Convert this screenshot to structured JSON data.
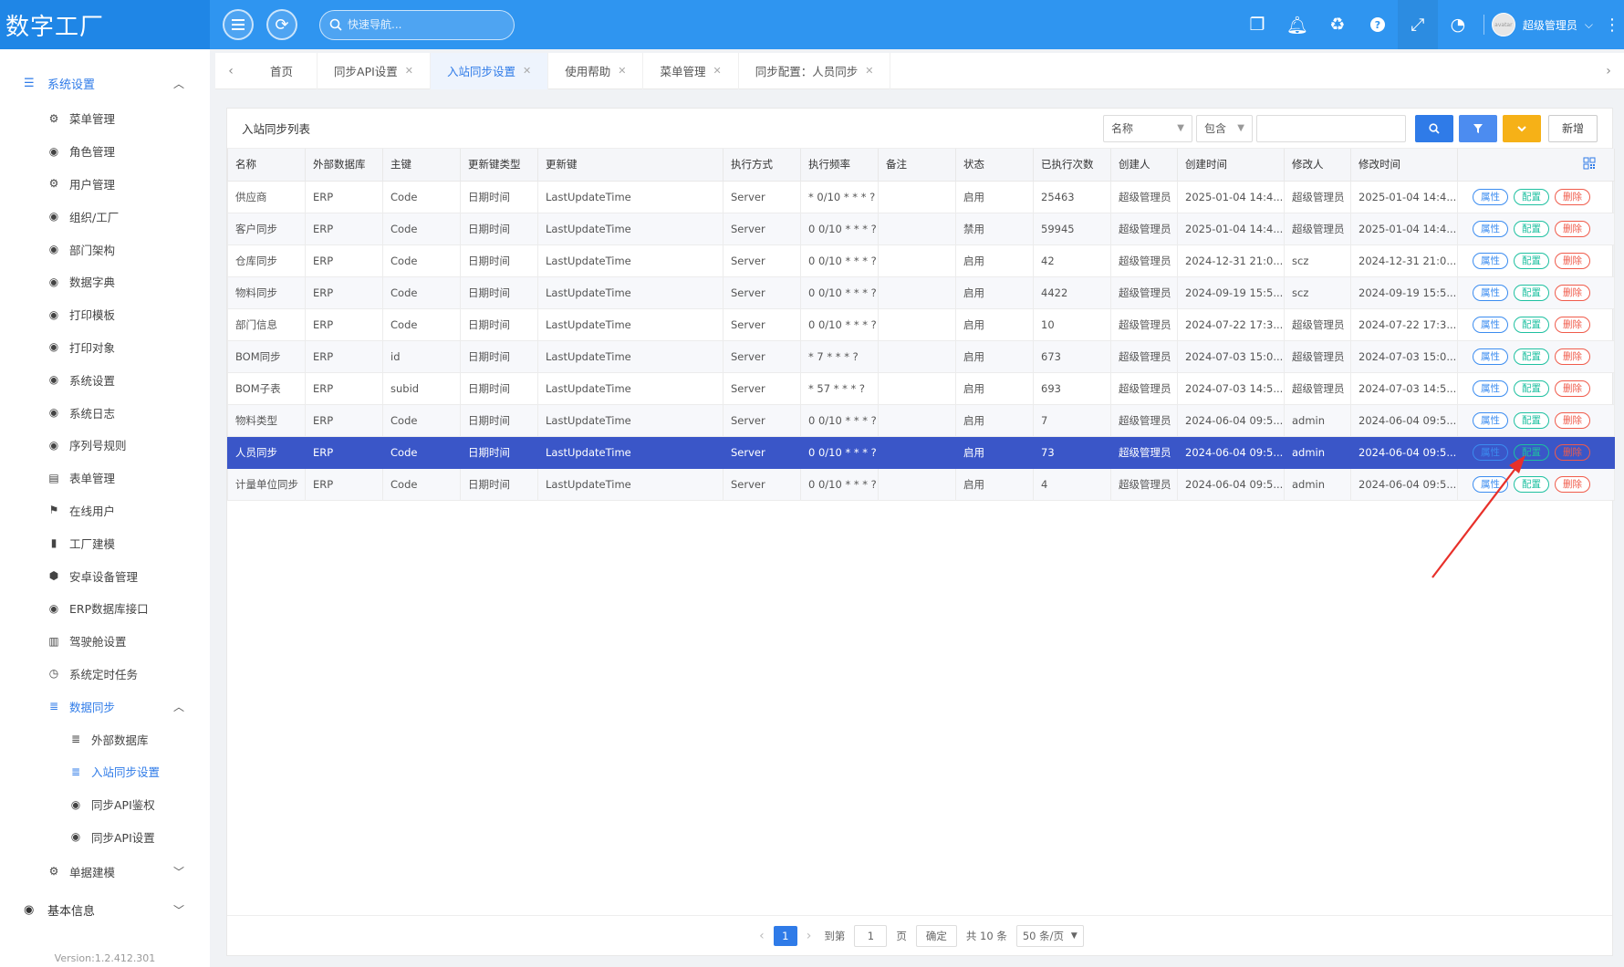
{
  "app": {
    "brand": "数字工厂",
    "search_placeholder": "快速导航...",
    "user_name": "超级管理员",
    "avatar_text": "avatar"
  },
  "sidebar": {
    "group": "系统设置",
    "items": [
      {
        "label": "菜单管理",
        "icon": "gear-icon"
      },
      {
        "label": "角色管理",
        "icon": "circle-icon"
      },
      {
        "label": "用户管理",
        "icon": "gear-icon"
      },
      {
        "label": "组织/工厂",
        "icon": "compass-icon"
      },
      {
        "label": "部门架构",
        "icon": "circle-icon"
      },
      {
        "label": "数据字典",
        "icon": "circle-icon"
      },
      {
        "label": "打印模板",
        "icon": "circle-icon"
      },
      {
        "label": "打印对象",
        "icon": "compass-icon"
      },
      {
        "label": "系统设置",
        "icon": "circle-icon"
      },
      {
        "label": "系统日志",
        "icon": "circle-icon"
      },
      {
        "label": "序列号规则",
        "icon": "compass-icon"
      },
      {
        "label": "表单管理",
        "icon": "form-icon"
      },
      {
        "label": "在线用户",
        "icon": "flag-icon"
      },
      {
        "label": "工厂建模",
        "icon": "cylinder-icon"
      },
      {
        "label": "安卓设备管理",
        "icon": "android-icon"
      },
      {
        "label": "ERP数据库接口",
        "icon": "circle-icon"
      },
      {
        "label": "驾驶舱设置",
        "icon": "bar-chart-icon"
      },
      {
        "label": "系统定时任务",
        "icon": "clock-icon"
      }
    ],
    "data_sync": {
      "label": "数据同步",
      "children": [
        {
          "label": "外部数据库"
        },
        {
          "label": "入站同步设置"
        },
        {
          "label": "同步API鉴权"
        },
        {
          "label": "同步API设置"
        }
      ]
    },
    "doc_model": "单据建模",
    "basic_info": "基本信息",
    "version": "Version:1.2.412.301"
  },
  "tabs": [
    {
      "label": "首页",
      "closable": false
    },
    {
      "label": "同步API设置",
      "closable": true
    },
    {
      "label": "入站同步设置",
      "closable": true,
      "active": true
    },
    {
      "label": "使用帮助",
      "closable": true
    },
    {
      "label": "菜单管理",
      "closable": true
    },
    {
      "label": "同步配置：人员同步",
      "closable": true
    }
  ],
  "list": {
    "title": "入站同步列表",
    "filter_field": "名称",
    "filter_op": "包含",
    "filter_value": "",
    "add_label": "新增",
    "columns": [
      "名称",
      "外部数据库",
      "主键",
      "更新键类型",
      "更新键",
      "执行方式",
      "执行频率",
      "备注",
      "状态",
      "已执行次数",
      "创建人",
      "创建时间",
      "修改人",
      "修改时间"
    ],
    "actions": {
      "attr": "属性",
      "config": "配置",
      "delete": "删除"
    },
    "rows": [
      [
        "供应商",
        "ERP",
        "Code",
        "日期时间",
        "LastUpdateTime",
        "Server",
        "* 0/10 * * * ?",
        "",
        "启用",
        "25463",
        "超级管理员",
        "2025-01-04 14:4...",
        "超级管理员",
        "2025-01-04 14:4..."
      ],
      [
        "客户同步",
        "ERP",
        "Code",
        "日期时间",
        "LastUpdateTime",
        "Server",
        "0 0/10 * * * ?",
        "",
        "禁用",
        "59945",
        "超级管理员",
        "2025-01-04 14:4...",
        "超级管理员",
        "2025-01-04 14:4..."
      ],
      [
        "仓库同步",
        "ERP",
        "Code",
        "日期时间",
        "LastUpdateTime",
        "Server",
        "0 0/10 * * * ?",
        "",
        "启用",
        "42",
        "超级管理员",
        "2024-12-31 21:0...",
        "scz",
        "2024-12-31 21:0..."
      ],
      [
        "物料同步",
        "ERP",
        "Code",
        "日期时间",
        "LastUpdateTime",
        "Server",
        "0 0/10 * * * ?",
        "",
        "启用",
        "4422",
        "超级管理员",
        "2024-09-19 15:5...",
        "scz",
        "2024-09-19 15:5..."
      ],
      [
        "部门信息",
        "ERP",
        "Code",
        "日期时间",
        "LastUpdateTime",
        "Server",
        "0 0/10 * * * ?",
        "",
        "启用",
        "10",
        "超级管理员",
        "2024-07-22 17:3...",
        "超级管理员",
        "2024-07-22 17:3..."
      ],
      [
        "BOM同步",
        "ERP",
        "id",
        "日期时间",
        "LastUpdateTime",
        "Server",
        "* 7 * * * ?",
        "",
        "启用",
        "673",
        "超级管理员",
        "2024-07-03 15:0...",
        "超级管理员",
        "2024-07-03 15:0..."
      ],
      [
        "BOM子表",
        "ERP",
        "subid",
        "日期时间",
        "LastUpdateTime",
        "Server",
        "* 57 * * * ?",
        "",
        "启用",
        "693",
        "超级管理员",
        "2024-07-03 14:5...",
        "超级管理员",
        "2024-07-03 14:5..."
      ],
      [
        "物料类型",
        "ERP",
        "Code",
        "日期时间",
        "LastUpdateTime",
        "Server",
        "0 0/10 * * * ?",
        "",
        "启用",
        "7",
        "超级管理员",
        "2024-06-04 09:5...",
        "admin",
        "2024-06-04 09:5..."
      ],
      [
        "人员同步",
        "ERP",
        "Code",
        "日期时间",
        "LastUpdateTime",
        "Server",
        "0 0/10 * * * ?",
        "",
        "启用",
        "73",
        "超级管理员",
        "2024-06-04 09:5...",
        "admin",
        "2024-06-04 09:5..."
      ],
      [
        "计量单位同步",
        "ERP",
        "Code",
        "日期时间",
        "LastUpdateTime",
        "Server",
        "0 0/10 * * * ?",
        "",
        "启用",
        "4",
        "超级管理员",
        "2024-06-04 09:5...",
        "admin",
        "2024-06-04 09:5..."
      ]
    ],
    "selected_row_index": 8
  },
  "pager": {
    "current": "1",
    "goto_label": "到第",
    "goto_value": "1",
    "page_label": "页",
    "confirm": "确定",
    "total": "共 10 条",
    "page_size": "50 条/页"
  },
  "colors": {
    "header": "#2f95f0",
    "accent": "#2f7be8",
    "selected_row": "#3a56c8",
    "annotation_arrow": "#e8302a"
  }
}
